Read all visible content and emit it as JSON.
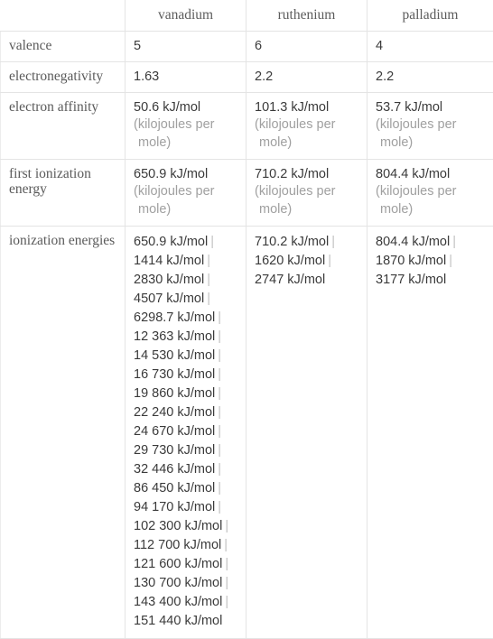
{
  "table": {
    "name": "element-properties-comparison",
    "columns": [
      {
        "key": "label",
        "header": ""
      },
      {
        "key": "vanadium",
        "header": "vanadium"
      },
      {
        "key": "ruthenium",
        "header": "ruthenium"
      },
      {
        "key": "palladium",
        "header": "palladium"
      }
    ],
    "rows": [
      {
        "label": "valence",
        "type": "plain",
        "cells": [
          {
            "value": "5"
          },
          {
            "value": "6"
          },
          {
            "value": "4"
          }
        ]
      },
      {
        "label": "electronegativity",
        "type": "plain",
        "cells": [
          {
            "value": "1.63"
          },
          {
            "value": "2.2"
          },
          {
            "value": "2.2"
          }
        ]
      },
      {
        "label": "electron affinity",
        "type": "valued",
        "cells": [
          {
            "value": "50.6 kJ/mol",
            "unit_line1": "(kilojoules per",
            "unit_line2": "mole)"
          },
          {
            "value": "101.3 kJ/mol",
            "unit_line1": "(kilojoules per",
            "unit_line2": "mole)"
          },
          {
            "value": "53.7 kJ/mol",
            "unit_line1": "(kilojoules per",
            "unit_line2": "mole)"
          }
        ]
      },
      {
        "label": "first ionization energy",
        "type": "valued",
        "cells": [
          {
            "value": "650.9 kJ/mol",
            "unit_line1": "(kilojoules per",
            "unit_line2": "mole)"
          },
          {
            "value": "710.2 kJ/mol",
            "unit_line1": "(kilojoules per",
            "unit_line2": "mole)"
          },
          {
            "value": "804.4 kJ/mol",
            "unit_line1": "(kilojoules per",
            "unit_line2": "mole)"
          }
        ]
      },
      {
        "label": "ionization energies",
        "type": "list",
        "separator": "|",
        "cells": [
          {
            "items": [
              "650.9 kJ/mol",
              "1414 kJ/mol",
              "2830 kJ/mol",
              "4507 kJ/mol",
              "6298.7 kJ/mol",
              "12 363 kJ/mol",
              "14 530 kJ/mol",
              "16 730 kJ/mol",
              "19 860 kJ/mol",
              "22 240 kJ/mol",
              "24 670 kJ/mol",
              "29 730 kJ/mol",
              "32 446 kJ/mol",
              "86 450 kJ/mol",
              "94 170 kJ/mol",
              "102 300 kJ/mol",
              "112 700 kJ/mol",
              "121 600 kJ/mol",
              "130 700 kJ/mol",
              "143 400 kJ/mol",
              "151 440 kJ/mol"
            ]
          },
          {
            "items": [
              "710.2 kJ/mol",
              "1620 kJ/mol",
              "2747 kJ/mol"
            ]
          },
          {
            "items": [
              "804.4 kJ/mol",
              "1870 kJ/mol",
              "3177 kJ/mol"
            ]
          }
        ]
      }
    ]
  },
  "colors": {
    "border": "#e4e4e4",
    "label_text": "#5a5a5a",
    "value_text": "#3a3a3a",
    "unit_text": "#a0a0a0",
    "separator": "#c2c2c2",
    "background": "#ffffff"
  }
}
